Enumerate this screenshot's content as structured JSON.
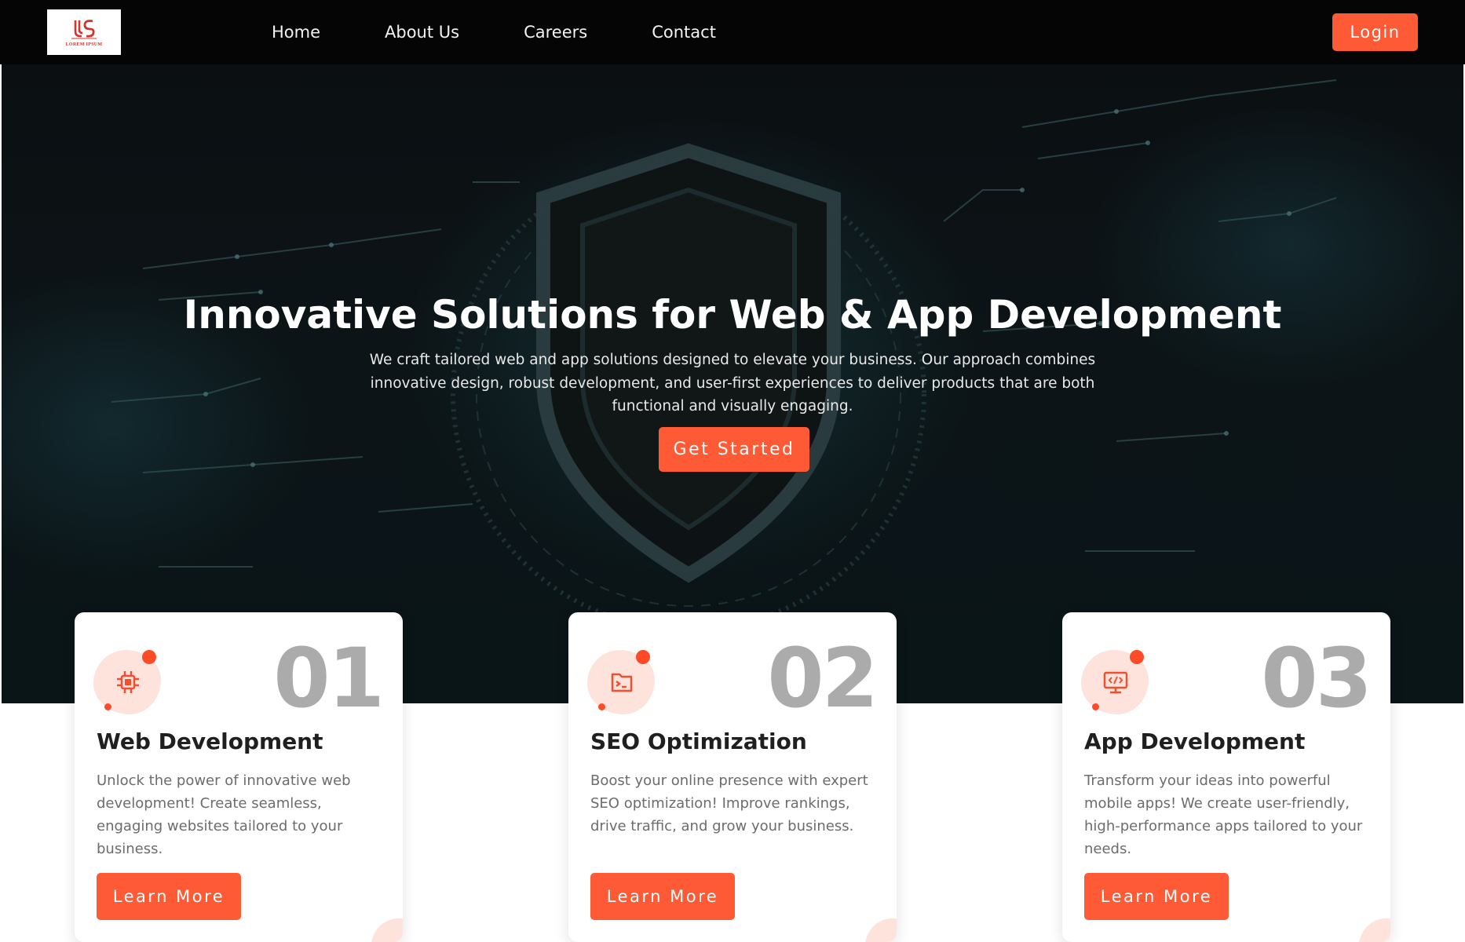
{
  "nav": {
    "logo_text": "LOREM IPSUM",
    "links": [
      {
        "label": "Home"
      },
      {
        "label": "About Us"
      },
      {
        "label": "Careers"
      },
      {
        "label": "Contact"
      }
    ],
    "login_label": "Login"
  },
  "hero": {
    "title": "Innovative Solutions for Web & App Development",
    "description": "We craft tailored web and app solutions designed to elevate your business. Our approach combines innovative design, robust development, and user-first experiences to deliver products that are both functional and visually engaging.",
    "cta_label": "Get Started",
    "background_icon": "shield-icon"
  },
  "cards": [
    {
      "number": "01",
      "title": "Web Development",
      "text": "Unlock the power of innovative web development! Create seamless, engaging websites tailored to your business.",
      "button_label": "Learn More",
      "icon": "chip-icon"
    },
    {
      "number": "02",
      "title": "SEO Optimization",
      "text": "Boost your online presence with expert SEO optimization! Improve rankings, drive traffic, and grow your business.",
      "button_label": "Learn More",
      "icon": "terminal-icon"
    },
    {
      "number": "03",
      "title": "App Development",
      "text": "Transform your ideas into powerful mobile apps! We create user-friendly, high-performance apps tailored to your needs.",
      "button_label": "Learn More",
      "icon": "code-monitor-icon"
    }
  ],
  "colors": {
    "accent": "#fd5a35",
    "nav_bg": "#050505",
    "card_number": "#ababab",
    "icon_blob": "#fde3dc"
  }
}
